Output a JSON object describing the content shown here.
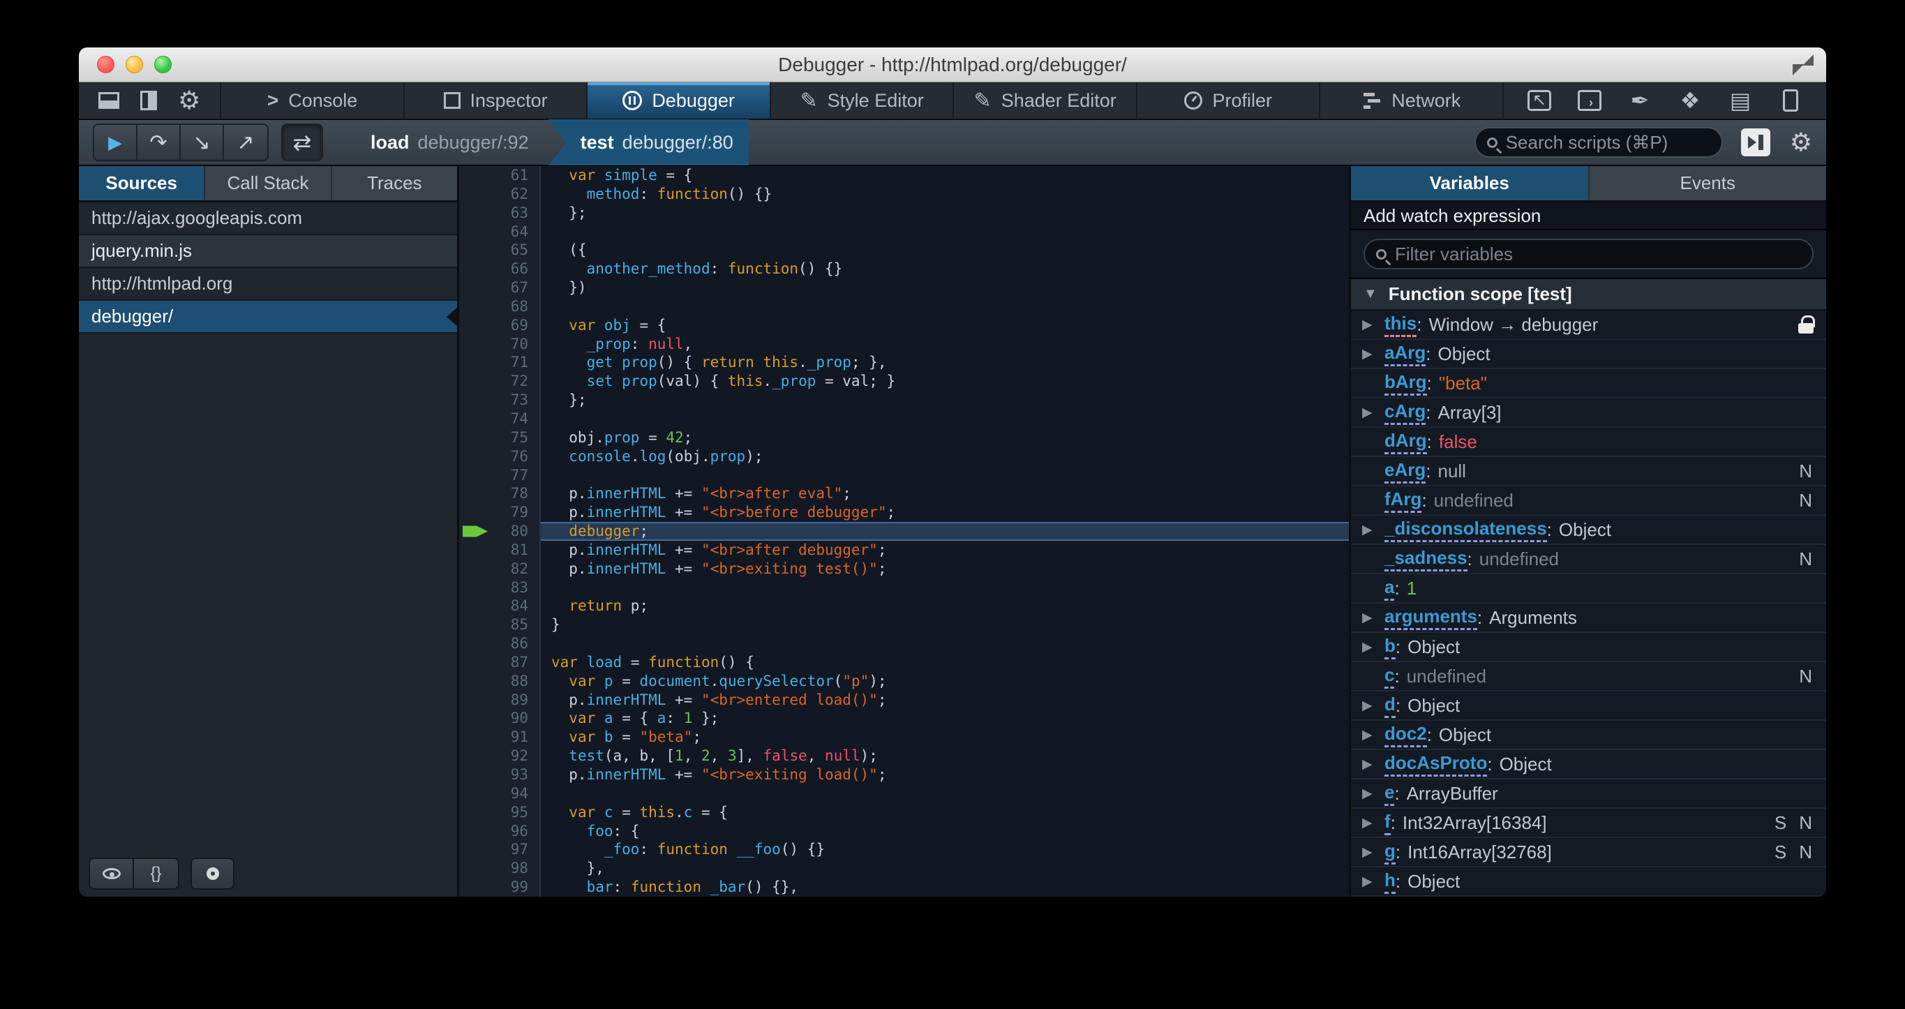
{
  "window": {
    "title": "Debugger - http://htmlpad.org/debugger/"
  },
  "toolbar": {
    "left_icons": [
      "dock-bottom-icon",
      "dock-side-icon",
      "gear-icon"
    ],
    "tabs": [
      {
        "label": "Console",
        "icon": "console-icon",
        "active": false
      },
      {
        "label": "Inspector",
        "icon": "inspector-icon",
        "active": false
      },
      {
        "label": "Debugger",
        "icon": "debugger-pause-icon",
        "active": true
      },
      {
        "label": "Style Editor",
        "icon": "style-editor-icon",
        "active": false
      },
      {
        "label": "Shader Editor",
        "icon": "shader-editor-icon",
        "active": false
      },
      {
        "label": "Profiler",
        "icon": "profiler-clock-icon",
        "active": false
      },
      {
        "label": "Network",
        "icon": "network-icon",
        "active": false
      }
    ],
    "right_icons": [
      "pick-element-icon",
      "split-console-icon",
      "paintbrush-icon",
      "tilt-3d-icon",
      "scratchpad-icon",
      "responsive-mode-icon"
    ]
  },
  "controls": {
    "buttons": [
      "resume-icon",
      "step-over-icon",
      "step-in-icon",
      "step-out-icon"
    ],
    "toggle_icon": "black-box-toggle-icon",
    "crumbs": [
      {
        "fn": "load",
        "loc": "debugger/:92",
        "active": false
      },
      {
        "fn": "test",
        "loc": "debugger/:80",
        "active": true
      }
    ],
    "search_placeholder": "Search scripts (⌘P)",
    "right_icons": [
      "toggle-panes-icon",
      "debugger-options-gear-icon"
    ]
  },
  "sources": {
    "tabs": [
      "Sources",
      "Call Stack",
      "Traces"
    ],
    "active_tab": "Sources",
    "items": [
      {
        "label": "http://ajax.googleapis.com",
        "kind": "group",
        "selected": false
      },
      {
        "label": "jquery.min.js",
        "kind": "file",
        "selected": false
      },
      {
        "label": "http://htmlpad.org",
        "kind": "group",
        "selected": false
      },
      {
        "label": "debugger/",
        "kind": "file",
        "selected": true
      }
    ],
    "bottom_icons": [
      "blackbox-eye-icon",
      "prettify-braces-icon",
      "toggle-breakpoints-icon"
    ],
    "prettify_glyph": "{}"
  },
  "editor": {
    "current_line": 80,
    "lines": [
      {
        "n": 61,
        "toks": [
          [
            "t",
            "  "
          ],
          [
            "k",
            "var"
          ],
          [
            "t",
            " "
          ],
          [
            "b",
            "simple"
          ],
          [
            "t",
            " = {"
          ]
        ]
      },
      {
        "n": 62,
        "toks": [
          [
            "t",
            "    "
          ],
          [
            "b",
            "method"
          ],
          [
            "t",
            ": "
          ],
          [
            "k",
            "function"
          ],
          [
            "t",
            "() {}"
          ]
        ]
      },
      {
        "n": 63,
        "toks": [
          [
            "t",
            "  };"
          ]
        ]
      },
      {
        "n": 64,
        "toks": []
      },
      {
        "n": 65,
        "toks": [
          [
            "t",
            "  ({"
          ]
        ]
      },
      {
        "n": 66,
        "toks": [
          [
            "t",
            "    "
          ],
          [
            "b",
            "another_method"
          ],
          [
            "t",
            ": "
          ],
          [
            "k",
            "function"
          ],
          [
            "t",
            "() {}"
          ]
        ]
      },
      {
        "n": 67,
        "toks": [
          [
            "t",
            "  })"
          ]
        ]
      },
      {
        "n": 68,
        "toks": []
      },
      {
        "n": 69,
        "toks": [
          [
            "t",
            "  "
          ],
          [
            "k",
            "var"
          ],
          [
            "t",
            " "
          ],
          [
            "b",
            "obj"
          ],
          [
            "t",
            " = {"
          ]
        ]
      },
      {
        "n": 70,
        "toks": [
          [
            "t",
            "    "
          ],
          [
            "b",
            "_prop"
          ],
          [
            "t",
            ": "
          ],
          [
            "a",
            "null"
          ],
          [
            "t",
            ","
          ]
        ]
      },
      {
        "n": 71,
        "toks": [
          [
            "t",
            "    "
          ],
          [
            "b",
            "get"
          ],
          [
            "t",
            " "
          ],
          [
            "b",
            "prop"
          ],
          [
            "t",
            "() { "
          ],
          [
            "k",
            "return"
          ],
          [
            "t",
            " "
          ],
          [
            "k",
            "this"
          ],
          [
            "t",
            "."
          ],
          [
            "b",
            "_prop"
          ],
          [
            "t",
            "; },"
          ]
        ]
      },
      {
        "n": 72,
        "toks": [
          [
            "t",
            "    "
          ],
          [
            "b",
            "set"
          ],
          [
            "t",
            " "
          ],
          [
            "b",
            "prop"
          ],
          [
            "t",
            "(val) { "
          ],
          [
            "k",
            "this"
          ],
          [
            "t",
            "."
          ],
          [
            "b",
            "_prop"
          ],
          [
            "t",
            " = val; }"
          ]
        ]
      },
      {
        "n": 73,
        "toks": [
          [
            "t",
            "  };"
          ]
        ]
      },
      {
        "n": 74,
        "toks": []
      },
      {
        "n": 75,
        "toks": [
          [
            "t",
            "  obj."
          ],
          [
            "b",
            "prop"
          ],
          [
            "t",
            " = "
          ],
          [
            "n",
            "42"
          ],
          [
            "t",
            ";"
          ]
        ]
      },
      {
        "n": 76,
        "toks": [
          [
            "t",
            "  "
          ],
          [
            "b",
            "console"
          ],
          [
            "t",
            "."
          ],
          [
            "b",
            "log"
          ],
          [
            "t",
            "(obj."
          ],
          [
            "b",
            "prop"
          ],
          [
            "t",
            ");"
          ]
        ]
      },
      {
        "n": 77,
        "toks": []
      },
      {
        "n": 78,
        "toks": [
          [
            "t",
            "  p."
          ],
          [
            "b",
            "innerHTML"
          ],
          [
            "t",
            " += "
          ],
          [
            "s",
            "\"<br>after eval\""
          ],
          [
            "t",
            ";"
          ]
        ]
      },
      {
        "n": 79,
        "toks": [
          [
            "t",
            "  p."
          ],
          [
            "b",
            "innerHTML"
          ],
          [
            "t",
            " += "
          ],
          [
            "s",
            "\"<br>before debugger\""
          ],
          [
            "t",
            ";"
          ]
        ]
      },
      {
        "n": 80,
        "toks": [
          [
            "t",
            "  "
          ],
          [
            "k",
            "debugger"
          ],
          [
            "t",
            ";"
          ]
        ]
      },
      {
        "n": 81,
        "toks": [
          [
            "t",
            "  p."
          ],
          [
            "b",
            "innerHTML"
          ],
          [
            "t",
            " += "
          ],
          [
            "s",
            "\"<br>after debugger\""
          ],
          [
            "t",
            ";"
          ]
        ]
      },
      {
        "n": 82,
        "toks": [
          [
            "t",
            "  p."
          ],
          [
            "b",
            "innerHTML"
          ],
          [
            "t",
            " += "
          ],
          [
            "s",
            "\"<br>exiting test()\""
          ],
          [
            "t",
            ";"
          ]
        ]
      },
      {
        "n": 83,
        "toks": []
      },
      {
        "n": 84,
        "toks": [
          [
            "t",
            "  "
          ],
          [
            "k",
            "return"
          ],
          [
            "t",
            " p;"
          ]
        ]
      },
      {
        "n": 85,
        "toks": [
          [
            "t",
            "}"
          ]
        ]
      },
      {
        "n": 86,
        "toks": []
      },
      {
        "n": 87,
        "toks": [
          [
            "k",
            "var"
          ],
          [
            "t",
            " "
          ],
          [
            "b",
            "load"
          ],
          [
            "t",
            " = "
          ],
          [
            "k",
            "function"
          ],
          [
            "t",
            "() {"
          ]
        ]
      },
      {
        "n": 88,
        "toks": [
          [
            "t",
            "  "
          ],
          [
            "k",
            "var"
          ],
          [
            "t",
            " "
          ],
          [
            "b",
            "p"
          ],
          [
            "t",
            " = "
          ],
          [
            "b",
            "document"
          ],
          [
            "t",
            "."
          ],
          [
            "b",
            "querySelector"
          ],
          [
            "t",
            "("
          ],
          [
            "s",
            "\"p\""
          ],
          [
            "t",
            ");"
          ]
        ]
      },
      {
        "n": 89,
        "toks": [
          [
            "t",
            "  p."
          ],
          [
            "b",
            "innerHTML"
          ],
          [
            "t",
            " += "
          ],
          [
            "s",
            "\"<br>entered load()\""
          ],
          [
            "t",
            ";"
          ]
        ]
      },
      {
        "n": 90,
        "toks": [
          [
            "t",
            "  "
          ],
          [
            "k",
            "var"
          ],
          [
            "t",
            " "
          ],
          [
            "b",
            "a"
          ],
          [
            "t",
            " = { "
          ],
          [
            "b",
            "a"
          ],
          [
            "t",
            ": "
          ],
          [
            "n",
            "1"
          ],
          [
            "t",
            " };"
          ]
        ]
      },
      {
        "n": 91,
        "toks": [
          [
            "t",
            "  "
          ],
          [
            "k",
            "var"
          ],
          [
            "t",
            " "
          ],
          [
            "b",
            "b"
          ],
          [
            "t",
            " = "
          ],
          [
            "s",
            "\"beta\""
          ],
          [
            "t",
            ";"
          ]
        ]
      },
      {
        "n": 92,
        "toks": [
          [
            "t",
            "  "
          ],
          [
            "b",
            "test"
          ],
          [
            "t",
            "(a, b, ["
          ],
          [
            "n",
            "1"
          ],
          [
            "t",
            ", "
          ],
          [
            "n",
            "2"
          ],
          [
            "t",
            ", "
          ],
          [
            "n",
            "3"
          ],
          [
            "t",
            "], "
          ],
          [
            "a",
            "false"
          ],
          [
            "t",
            ", "
          ],
          [
            "a",
            "null"
          ],
          [
            "t",
            ");"
          ]
        ]
      },
      {
        "n": 93,
        "toks": [
          [
            "t",
            "  p."
          ],
          [
            "b",
            "innerHTML"
          ],
          [
            "t",
            " += "
          ],
          [
            "s",
            "\"<br>exiting load()\""
          ],
          [
            "t",
            ";"
          ]
        ]
      },
      {
        "n": 94,
        "toks": []
      },
      {
        "n": 95,
        "toks": [
          [
            "t",
            "  "
          ],
          [
            "k",
            "var"
          ],
          [
            "t",
            " "
          ],
          [
            "b",
            "c"
          ],
          [
            "t",
            " = "
          ],
          [
            "k",
            "this"
          ],
          [
            "t",
            "."
          ],
          [
            "b",
            "c"
          ],
          [
            "t",
            " = {"
          ]
        ]
      },
      {
        "n": 96,
        "toks": [
          [
            "t",
            "    "
          ],
          [
            "b",
            "foo"
          ],
          [
            "t",
            ": {"
          ]
        ]
      },
      {
        "n": 97,
        "toks": [
          [
            "t",
            "      "
          ],
          [
            "b",
            "_foo"
          ],
          [
            "t",
            ": "
          ],
          [
            "k",
            "function"
          ],
          [
            "t",
            " "
          ],
          [
            "b",
            "__foo"
          ],
          [
            "t",
            "() {}"
          ]
        ]
      },
      {
        "n": 98,
        "toks": [
          [
            "t",
            "    },"
          ]
        ]
      },
      {
        "n": 99,
        "toks": [
          [
            "t",
            "    "
          ],
          [
            "b",
            "bar"
          ],
          [
            "t",
            ": "
          ],
          [
            "k",
            "function"
          ],
          [
            "t",
            " "
          ],
          [
            "b",
            "_bar"
          ],
          [
            "t",
            "() {},"
          ]
        ]
      }
    ]
  },
  "variables": {
    "tabs": [
      "Variables",
      "Events"
    ],
    "active_tab": "Variables",
    "watch_label": "Add watch expression",
    "filter_placeholder": "Filter variables",
    "scope": "Function scope [test]",
    "rows": [
      {
        "name": "this",
        "value": "Window → debugger",
        "type": "object",
        "expandable": true,
        "badges": [],
        "lock": true,
        "underline": "this"
      },
      {
        "name": "aArg",
        "value": "Object",
        "type": "object",
        "expandable": true,
        "badges": [],
        "lock": false,
        "underline": "default"
      },
      {
        "name": "bArg",
        "value": "\"beta\"",
        "type": "string",
        "expandable": false,
        "badges": [],
        "lock": false,
        "underline": "default"
      },
      {
        "name": "cArg",
        "value": "Array[3]",
        "type": "object",
        "expandable": true,
        "badges": [],
        "lock": false,
        "underline": "default"
      },
      {
        "name": "dArg",
        "value": "false",
        "type": "boolean",
        "expandable": false,
        "badges": [],
        "lock": false,
        "underline": "default"
      },
      {
        "name": "eArg",
        "value": "null",
        "type": "null",
        "expandable": false,
        "badges": [
          "N"
        ],
        "lock": false,
        "underline": "default"
      },
      {
        "name": "fArg",
        "value": "undefined",
        "type": "undefined",
        "expandable": false,
        "badges": [
          "N"
        ],
        "lock": false,
        "underline": "default"
      },
      {
        "name": "_disconsolateness",
        "value": "Object",
        "type": "object",
        "expandable": true,
        "badges": [],
        "lock": false,
        "underline": "default"
      },
      {
        "name": "_sadness",
        "value": "undefined",
        "type": "undefined",
        "expandable": false,
        "badges": [
          "N"
        ],
        "lock": false,
        "underline": "default"
      },
      {
        "name": "a",
        "value": "1",
        "type": "number",
        "expandable": false,
        "badges": [],
        "lock": false,
        "underline": "default"
      },
      {
        "name": "arguments",
        "value": "Arguments",
        "type": "object",
        "expandable": true,
        "badges": [],
        "lock": false,
        "underline": "default"
      },
      {
        "name": "b",
        "value": "Object",
        "type": "object",
        "expandable": true,
        "badges": [],
        "lock": false,
        "underline": "default"
      },
      {
        "name": "c",
        "value": "undefined",
        "type": "undefined",
        "expandable": false,
        "badges": [
          "N"
        ],
        "lock": false,
        "underline": "default"
      },
      {
        "name": "d",
        "value": "Object",
        "type": "object",
        "expandable": true,
        "badges": [],
        "lock": false,
        "underline": "default"
      },
      {
        "name": "doc2",
        "value": "Object",
        "type": "object",
        "expandable": true,
        "badges": [],
        "lock": false,
        "underline": "default"
      },
      {
        "name": "docAsProto",
        "value": "Object",
        "type": "object",
        "expandable": true,
        "badges": [],
        "lock": false,
        "underline": "default"
      },
      {
        "name": "e",
        "value": "ArrayBuffer",
        "type": "object",
        "expandable": true,
        "badges": [],
        "lock": false,
        "underline": "default"
      },
      {
        "name": "f",
        "value": "Int32Array[16384]",
        "type": "object",
        "expandable": true,
        "badges": [
          "S",
          "N"
        ],
        "lock": false,
        "underline": "default"
      },
      {
        "name": "g",
        "value": "Int16Array[32768]",
        "type": "object",
        "expandable": true,
        "badges": [
          "S",
          "N"
        ],
        "lock": false,
        "underline": "default"
      },
      {
        "name": "h",
        "value": "Object",
        "type": "object",
        "expandable": true,
        "badges": [],
        "lock": false,
        "underline": "default"
      }
    ]
  },
  "colors": {
    "accent_blue": "#1d4f73",
    "keyword": "#d99b28",
    "identifier": "#46afe3",
    "string": "#d96629",
    "number": "#70bf53",
    "atom": "#eb5368",
    "exec_arrow": "#6cc83a"
  }
}
